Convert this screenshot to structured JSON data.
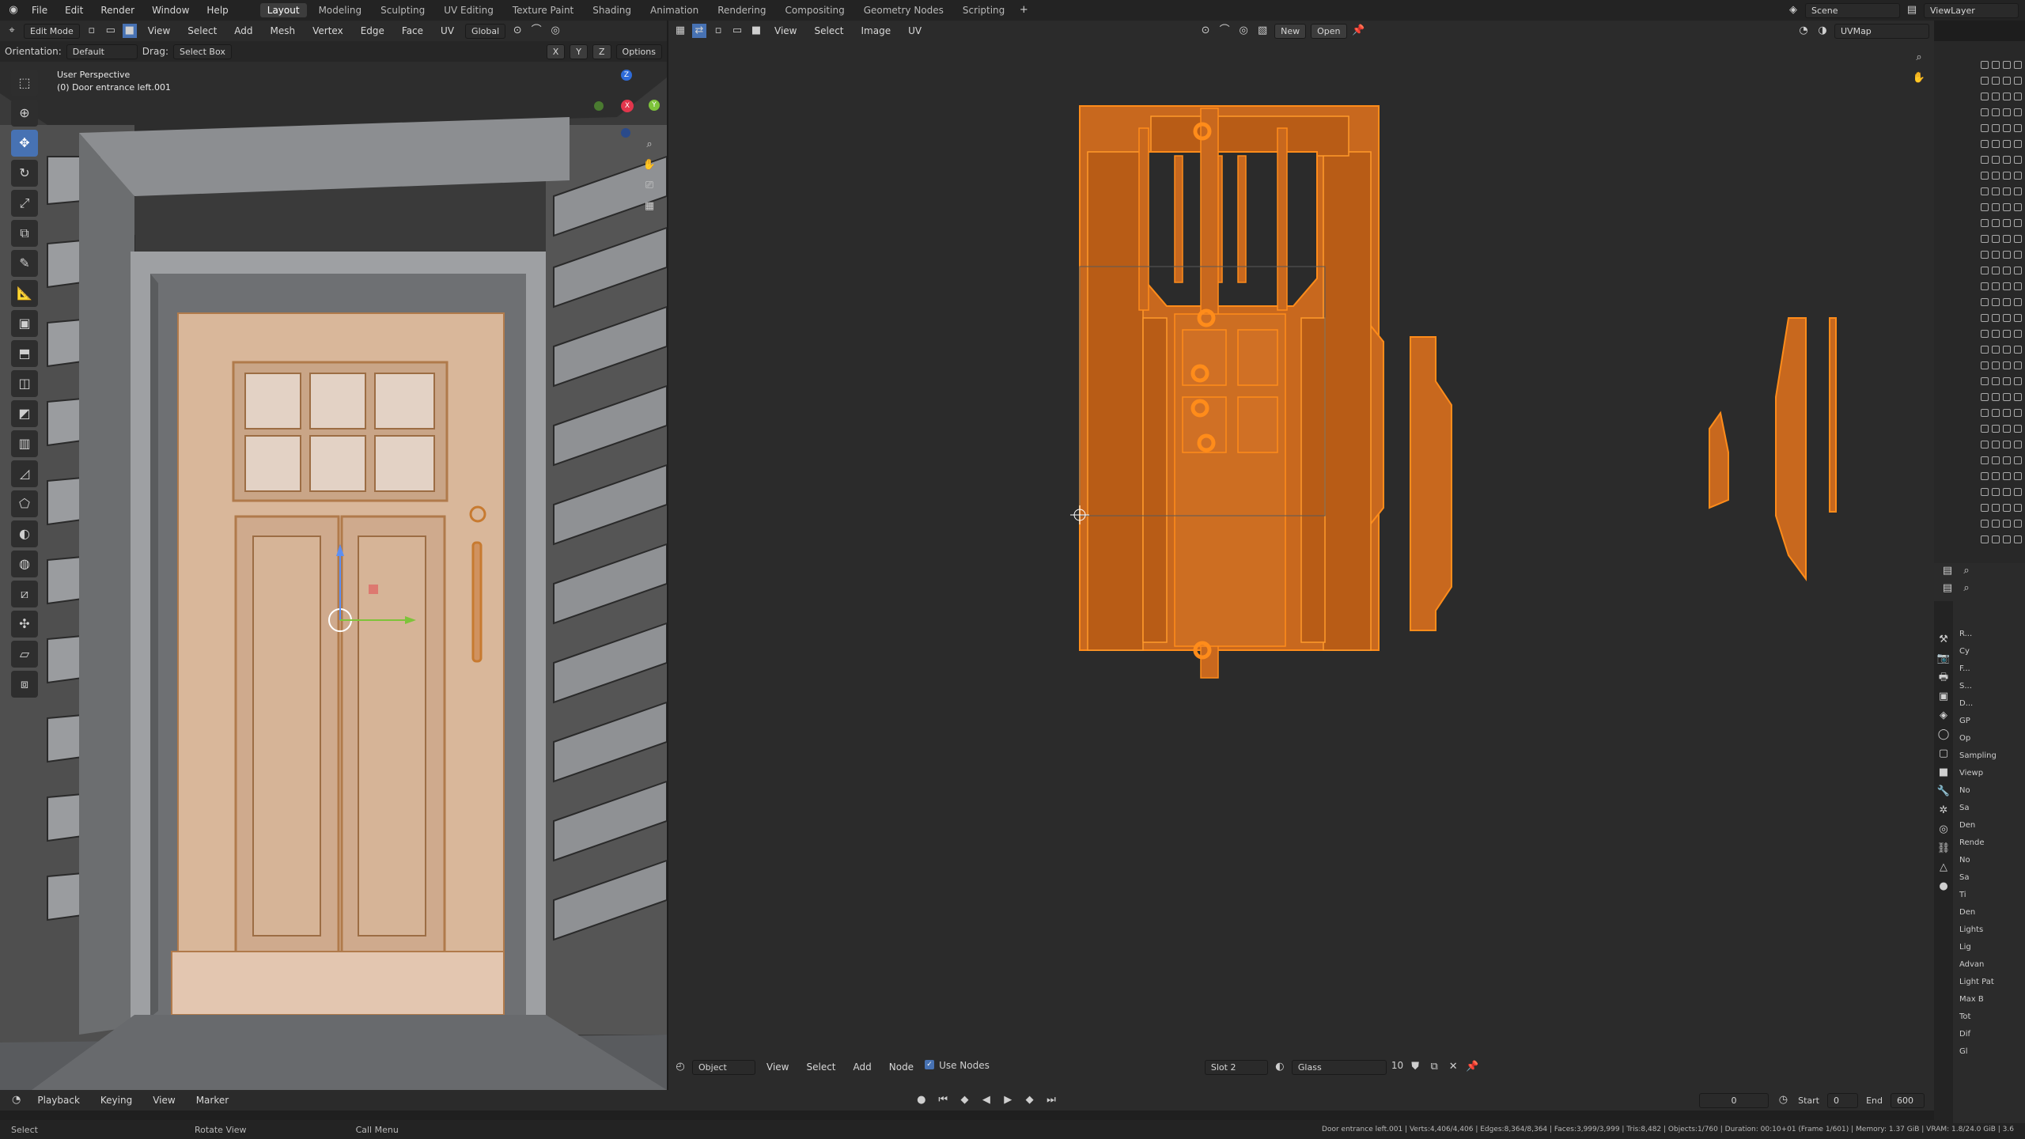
{
  "menubar": {
    "items": [
      "File",
      "Edit",
      "Render",
      "Window",
      "Help"
    ],
    "workspaces": [
      "Layout",
      "Modeling",
      "Sculpting",
      "UV Editing",
      "Texture Paint",
      "Shading",
      "Animation",
      "Rendering",
      "Compositing",
      "Geometry Nodes",
      "Scripting"
    ],
    "active_workspace": "Layout",
    "scene": "Scene",
    "view_layer": "ViewLayer"
  },
  "viewport_header": {
    "mode": "Edit Mode",
    "menus": [
      "View",
      "Select",
      "Add",
      "Mesh",
      "Vertex",
      "Edge",
      "Face",
      "UV"
    ],
    "transform": "Global"
  },
  "viewport_subheader": {
    "orientation_label": "Orientation:",
    "orientation": "Default",
    "drag_label": "Drag:",
    "drag": "Select Box",
    "options": "Options",
    "axes": [
      "X",
      "Y",
      "Z"
    ]
  },
  "viewport": {
    "view_name": "User Perspective",
    "object": "(0) Door entrance left.001",
    "gizmo": [
      "X",
      "Y",
      "Z"
    ]
  },
  "uv_header": {
    "menus": [
      "View",
      "Select",
      "Image",
      "UV"
    ],
    "new": "New",
    "open": "Open",
    "uvmap": "UVMap"
  },
  "node_header": {
    "mode": "Object",
    "menus": [
      "View",
      "Select",
      "Add",
      "Node"
    ],
    "use_nodes": "Use Nodes",
    "slot": "Slot 2",
    "material": "Glass",
    "users": "10"
  },
  "timeline": {
    "menus": [
      "Playback",
      "Keying",
      "View",
      "Marker"
    ],
    "frame": "0",
    "start_label": "Start",
    "start": "0",
    "end_label": "End",
    "end": "600"
  },
  "status": {
    "select": "Select",
    "rotate": "Rotate View",
    "menu": "Call Menu",
    "stats": "Door entrance left.001 | Verts:4,406/4,406 | Edges:8,364/8,364 | Faces:3,999/3,999 | Tris:8,482 | Objects:1/760 | Duration: 00:10+01 (Frame 1/601) | Memory: 1.37 GiB | VRAM: 1.8/24.0 GiB | 3.6"
  },
  "properties": {
    "items": [
      "R...",
      "Cy",
      "F...",
      "S...",
      "D...",
      "GP",
      "Op",
      "Sampling",
      "Viewp",
      "No",
      "Sa",
      "Den",
      "Rende",
      "No",
      "Sa",
      "Ti",
      "Den",
      "Lights",
      "Lig",
      "Advan",
      "Light Pat",
      "Max B",
      "Tot",
      "Dif",
      "Gl"
    ]
  },
  "colors": {
    "accent": "#4772b3",
    "uv_fill": "#c8681e",
    "uv_edge": "#ff8c1a"
  }
}
